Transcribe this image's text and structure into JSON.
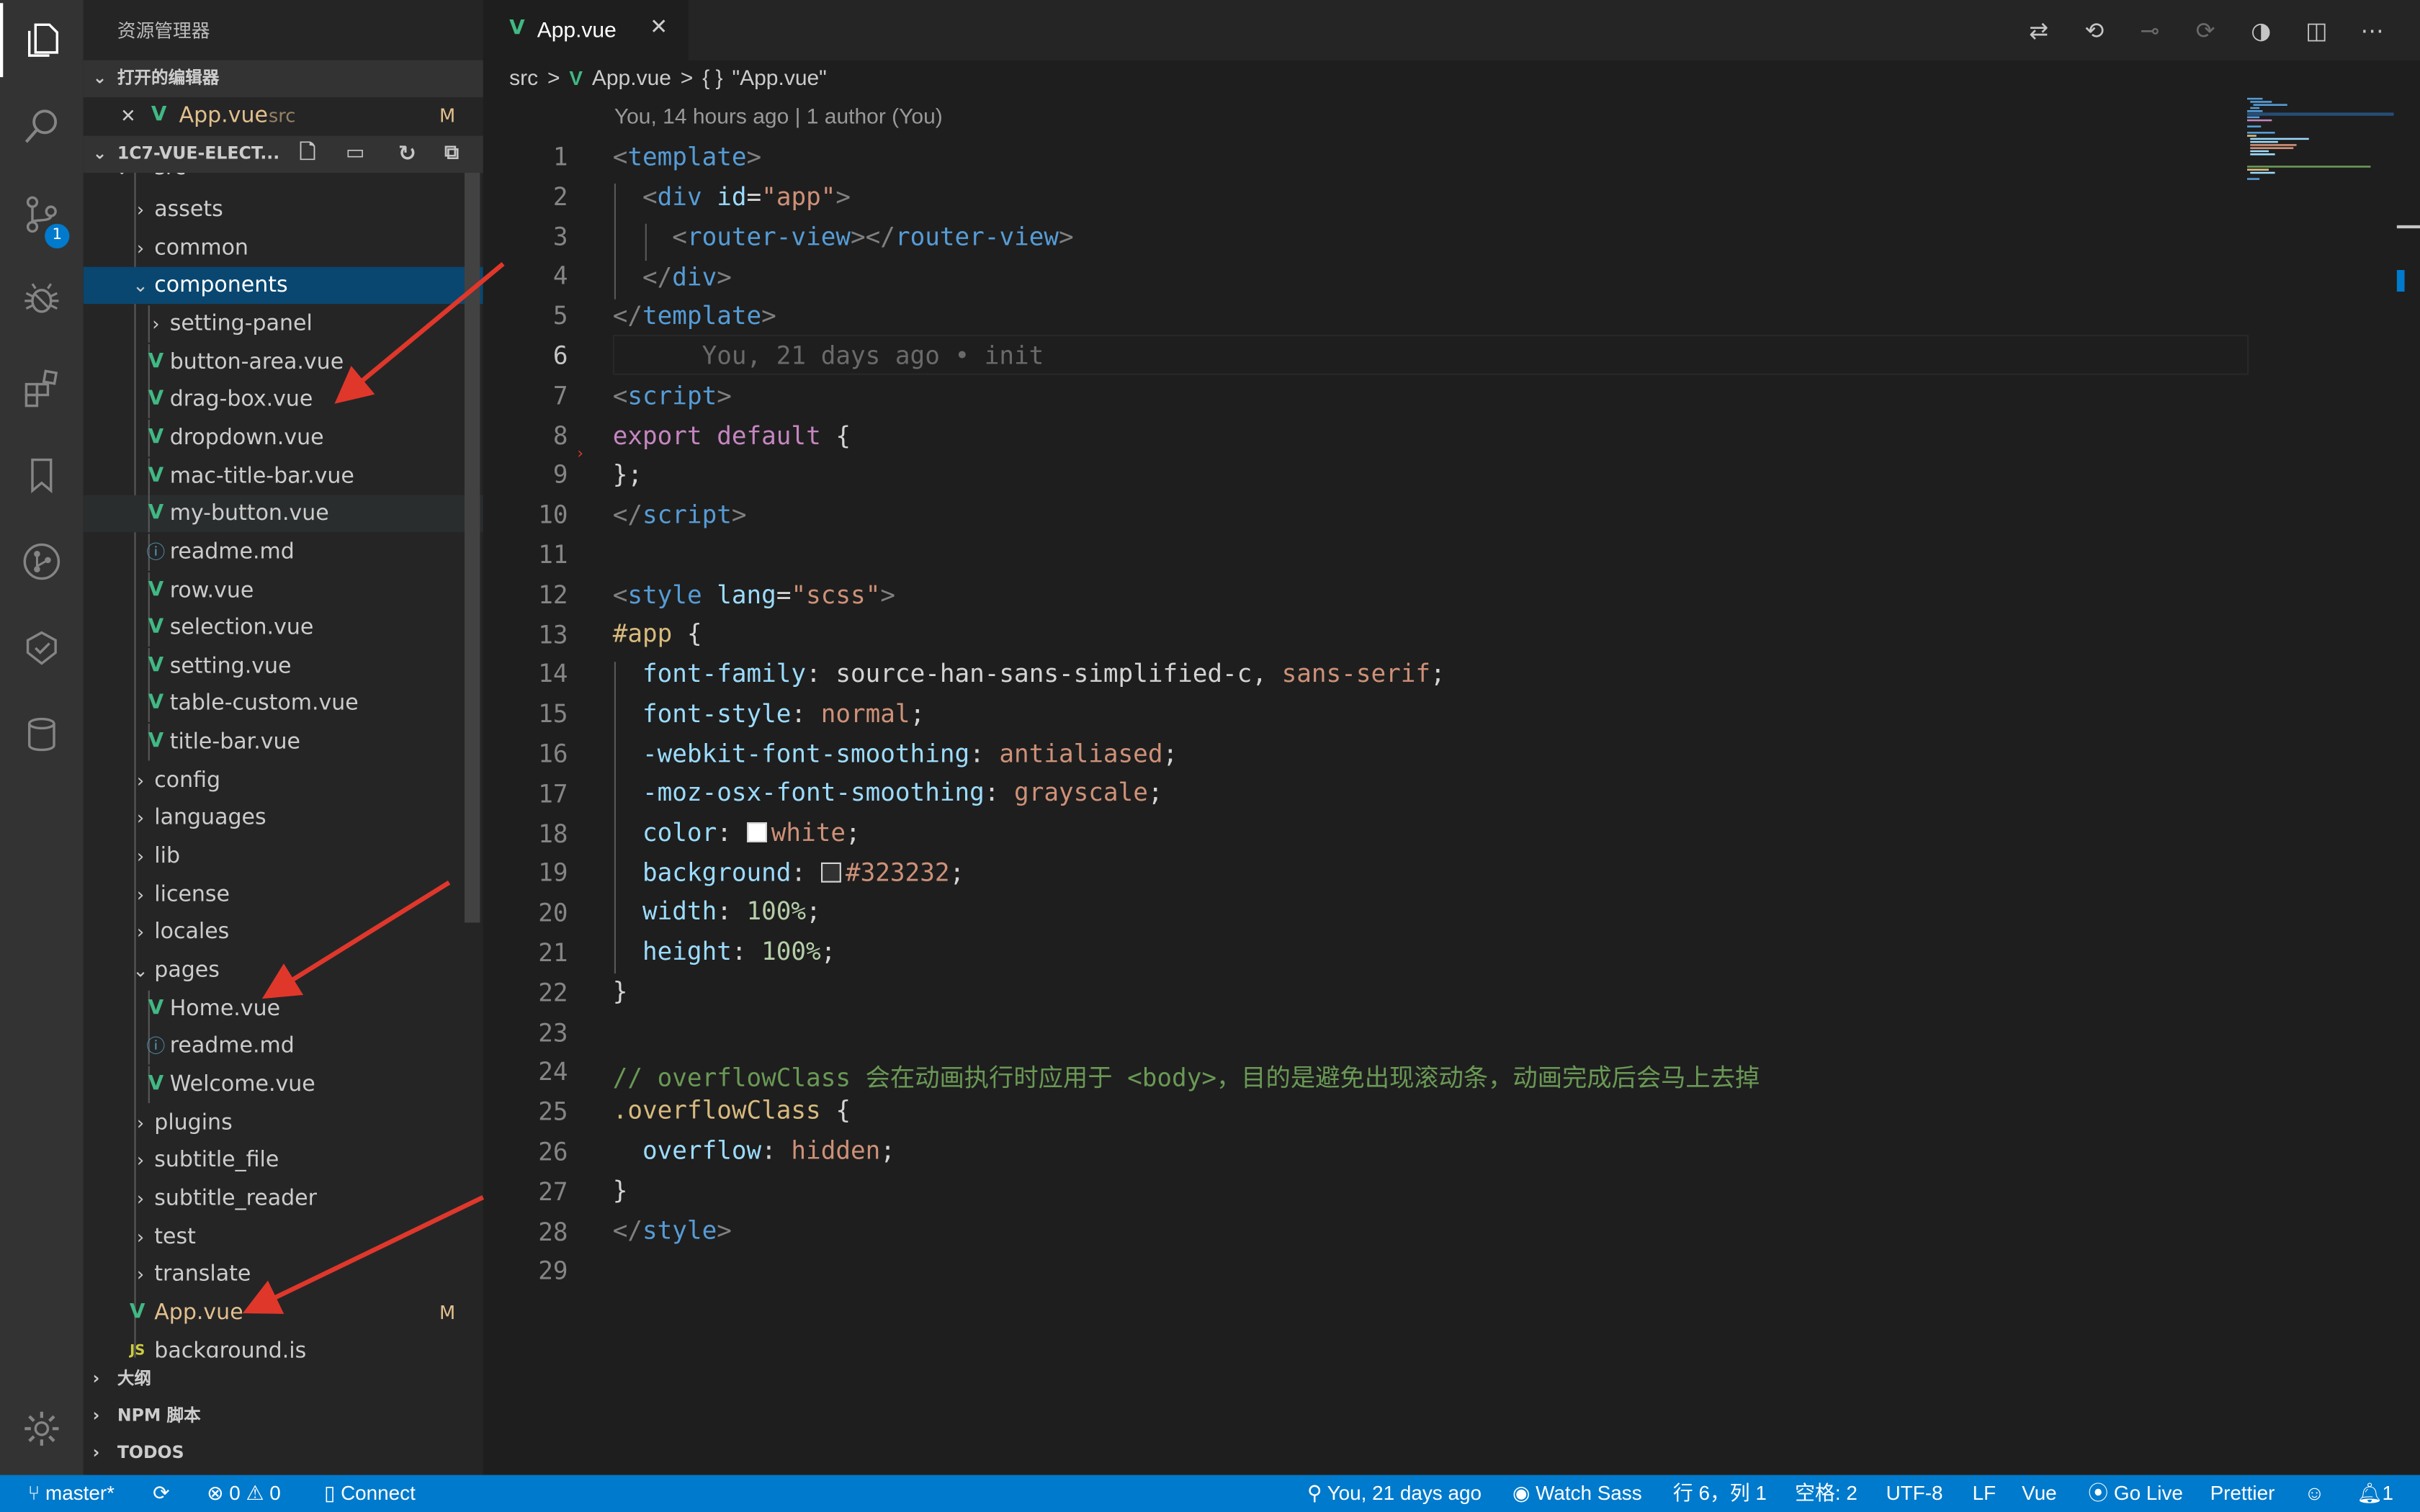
{
  "sidebar": {
    "title": "资源管理器",
    "open_editors": {
      "label": "打开的编辑器",
      "file": "App.vue",
      "dir": "src",
      "status": "M"
    },
    "workspace": {
      "label": "1C7-VUE-ELECT..."
    },
    "partial_top": "src",
    "tree": [
      {
        "label": "assets"
      },
      {
        "label": "common"
      },
      {
        "label": "components"
      },
      {
        "label": "setting-panel"
      },
      {
        "label": "button-area.vue"
      },
      {
        "label": "drag-box.vue"
      },
      {
        "label": "dropdown.vue"
      },
      {
        "label": "mac-title-bar.vue"
      },
      {
        "label": "my-button.vue"
      },
      {
        "label": "readme.md"
      },
      {
        "label": "row.vue"
      },
      {
        "label": "selection.vue"
      },
      {
        "label": "setting.vue"
      },
      {
        "label": "table-custom.vue"
      },
      {
        "label": "title-bar.vue"
      },
      {
        "label": "config"
      },
      {
        "label": "languages"
      },
      {
        "label": "lib"
      },
      {
        "label": "license"
      },
      {
        "label": "locales"
      },
      {
        "label": "pages"
      },
      {
        "label": "Home.vue"
      },
      {
        "label": "readme.md"
      },
      {
        "label": "Welcome.vue"
      },
      {
        "label": "plugins"
      },
      {
        "label": "subtitle_file"
      },
      {
        "label": "subtitle_reader"
      },
      {
        "label": "test"
      },
      {
        "label": "translate"
      },
      {
        "label": "App.vue",
        "status": "M"
      },
      {
        "label": "background.js"
      }
    ],
    "outline": "大纲",
    "npm": "NPM 脚本",
    "todos": "TODOS"
  },
  "activity": {
    "scm_badge": "1"
  },
  "editor": {
    "tab_label": "App.vue",
    "breadcrumb": [
      "src",
      ">",
      "App.vue",
      ">",
      "{ }",
      "\"App.vue\""
    ],
    "codelens": "You, 14 hours ago | 1 author (You)",
    "blame_inline": "You, 21 days ago • init",
    "line_numbers": [
      "1",
      "2",
      "3",
      "4",
      "5",
      "6",
      "7",
      "8",
      "9",
      "10",
      "11",
      "12",
      "13",
      "14",
      "15",
      "16",
      "17",
      "18",
      "19",
      "20",
      "21",
      "22",
      "23",
      "24",
      "25",
      "26",
      "27",
      "28",
      "29"
    ],
    "code": {
      "l1": [
        "<",
        "template",
        ">"
      ],
      "l2": [
        "<",
        "div",
        "id",
        "=",
        "\"app\"",
        ">"
      ],
      "l3": [
        "<",
        "router-view",
        "></",
        "router-view",
        ">"
      ],
      "l4": [
        "</",
        "div",
        ">"
      ],
      "l5": [
        "</",
        "template",
        ">"
      ],
      "l7": [
        "<",
        "script",
        ">"
      ],
      "l8": [
        "export",
        "default",
        "{"
      ],
      "l9": "};",
      "l10": [
        "</",
        "script",
        ">"
      ],
      "l12": [
        "<",
        "style",
        "lang",
        "=",
        "\"scss\"",
        ">"
      ],
      "l13": [
        "#app",
        "{"
      ],
      "l14": [
        "font-family",
        ": source-han-sans-simplified-c, ",
        "sans-serif",
        ";"
      ],
      "l15": [
        "font-style",
        ": ",
        "normal",
        ";"
      ],
      "l16": [
        "-webkit-font-smoothing",
        ": ",
        "antialiased",
        ";"
      ],
      "l17": [
        "-moz-osx-font-smoothing",
        ": ",
        "grayscale",
        ";"
      ],
      "l18": [
        "color",
        ": ",
        "white",
        ";"
      ],
      "l19": [
        "background",
        ": ",
        "#323232",
        ";"
      ],
      "l20": [
        "width",
        ": ",
        "100%",
        ";"
      ],
      "l21": [
        "height",
        ": ",
        "100%",
        ";"
      ],
      "l22": "}",
      "l24": "// overflowClass 会在动画执行时应用于 <body>，目的是避免出现滚动条，动画完成后会马上去掉",
      "l25": [
        ".overflowClass",
        "{"
      ],
      "l26": [
        "overflow",
        ": ",
        "hidden",
        ";"
      ],
      "l27": "}",
      "l28": [
        "</",
        "style",
        ">"
      ]
    }
  },
  "status": {
    "branch": "master*",
    "errors": "0",
    "warnings": "0",
    "connect": "Connect",
    "blame": "You, 21 days ago",
    "watch_sass": "Watch Sass",
    "position": "行 6，列 1",
    "spaces": "空格: 2",
    "encoding": "UTF-8",
    "eol": "LF",
    "language": "Vue",
    "go_live": "Go Live",
    "prettier": "Prettier",
    "notifications": "1"
  },
  "colors": {
    "accent": "#007acc",
    "arrow": "#e0372b",
    "vue": "#41b883"
  }
}
